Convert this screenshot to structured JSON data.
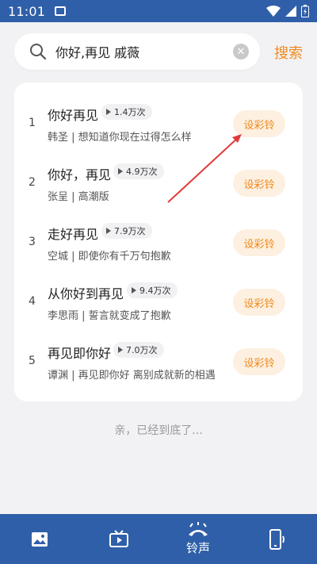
{
  "status_bar": {
    "time": "11:01"
  },
  "search": {
    "query": "你好,再见 戚薇",
    "button_label": "搜索"
  },
  "results": [
    {
      "index": "1",
      "title": "你好再见",
      "plays": "1.4万次",
      "subtitle": "韩圣 | 想知道你现在过得怎么样",
      "action": "设彩铃"
    },
    {
      "index": "2",
      "title": "你好，再见",
      "plays": "4.9万次",
      "subtitle": "张呈 | 高潮版",
      "action": "设彩铃"
    },
    {
      "index": "3",
      "title": "走好再见",
      "plays": "7.9万次",
      "subtitle": "空城 | 即使你有千万句抱歉",
      "action": "设彩铃"
    },
    {
      "index": "4",
      "title": "从你好到再见",
      "plays": "9.4万次",
      "subtitle": "李思雨 | 誓言就变成了抱歉",
      "action": "设彩铃"
    },
    {
      "index": "5",
      "title": "再见即你好",
      "plays": "7.0万次",
      "subtitle": "谭渊 | 再见即你好 离别成就新的相遇",
      "action": "设彩铃"
    }
  ],
  "end_text": "亲，已经到底了...",
  "bottom_nav": {
    "ringtone_label": "铃声"
  },
  "colors": {
    "primary": "#2f5fa8",
    "accent": "#f08a1c",
    "accent_bg": "#fdf0e0"
  }
}
